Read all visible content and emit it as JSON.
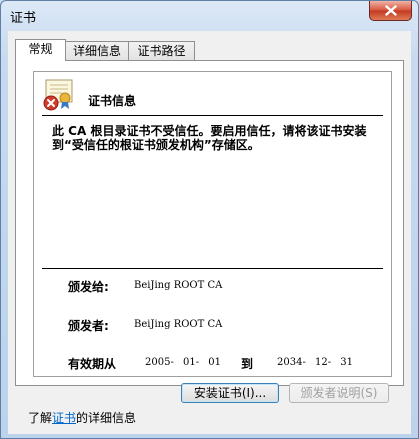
{
  "window": {
    "title": "证书"
  },
  "tabs": [
    {
      "label": "常规",
      "active": true
    },
    {
      "label": "详细信息",
      "active": false
    },
    {
      "label": "证书路径",
      "active": false
    }
  ],
  "certificate": {
    "heading": "证书信息",
    "warning": "此 CA 根目录证书不受信任。要启用信任，请将该证书安装到“受信任的根证书颁发机构”存储区。",
    "issued_to_label": "颁发给:",
    "issued_to": "BeiJing ROOT CA",
    "issued_by_label": "颁发者:",
    "issued_by": "BeiJing ROOT CA",
    "validity_label": "有效期从",
    "valid_from": "2005- 01- 01",
    "to_label": "到",
    "valid_to": "2034- 12- 31"
  },
  "buttons": {
    "install": "安装证书(I)...",
    "issuer_statement": "颁发者说明(S)"
  },
  "footer": {
    "prefix": "了解",
    "link": "证书",
    "suffix": "的详细信息"
  },
  "colors": {
    "error_red": "#d23a2c",
    "link_blue": "#0066cc",
    "disabled_gray": "#a0a0a0"
  },
  "icons": {
    "close": "close-icon",
    "certificate": "certificate-error-icon"
  }
}
